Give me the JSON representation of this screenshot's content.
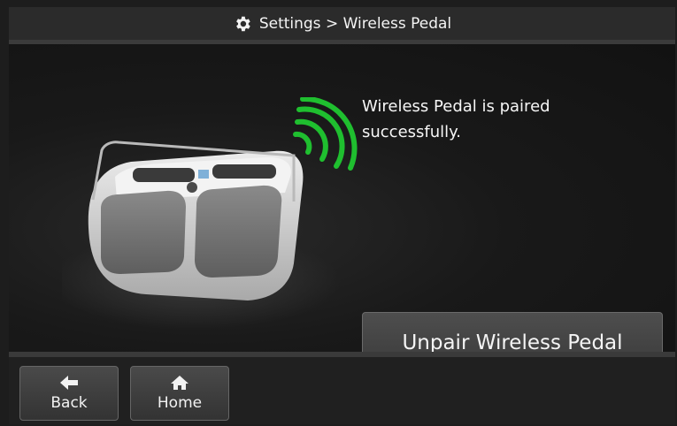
{
  "header": {
    "title": "Settings > Wireless Pedal",
    "icon": "gear-icon"
  },
  "main": {
    "message": "Wireless Pedal is paired successfully.",
    "unpair_label": "Unpair Wireless Pedal",
    "signal_color": "#1fbf2f"
  },
  "footer": {
    "back_label": "Back",
    "back_icon": "arrow-left-icon",
    "home_label": "Home",
    "home_icon": "home-icon"
  }
}
